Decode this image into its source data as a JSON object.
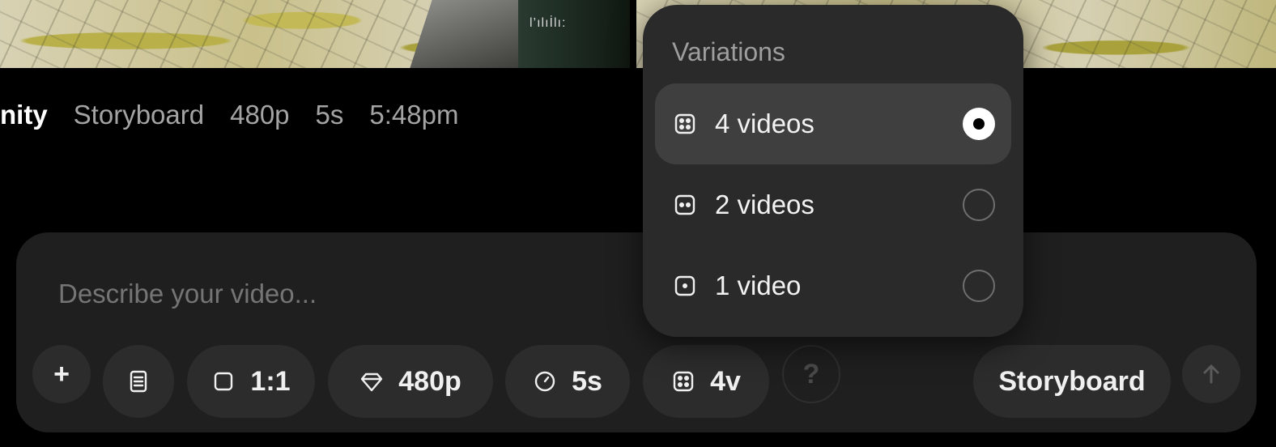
{
  "thumbnails": {
    "watermark_text": "l’ılıİlı:"
  },
  "meta_row": [
    "nity",
    "Storyboard",
    "480p",
    "5s",
    "5:48pm"
  ],
  "composer": {
    "placeholder": "Describe your video...",
    "toolbar": {
      "add_label": "+",
      "aspect_label": "1:1",
      "resolution_label": "480p",
      "duration_label": "5s",
      "variations_label": "4v",
      "help_label": "?",
      "storyboard_label": "Storyboard"
    }
  },
  "variations_menu": {
    "title": "Variations",
    "options": [
      {
        "label": "4 videos",
        "icon": "four-dots-icon",
        "selected": true
      },
      {
        "label": "2 videos",
        "icon": "two-dots-icon",
        "selected": false
      },
      {
        "label": "1 video",
        "icon": "one-dot-icon",
        "selected": false
      }
    ]
  },
  "colors": {
    "background": "#000000",
    "panel": "#1f1f1f",
    "pill": "#2c2c2c",
    "menu": "#2a2a2a",
    "menu_selected": "#3f3f3f"
  }
}
